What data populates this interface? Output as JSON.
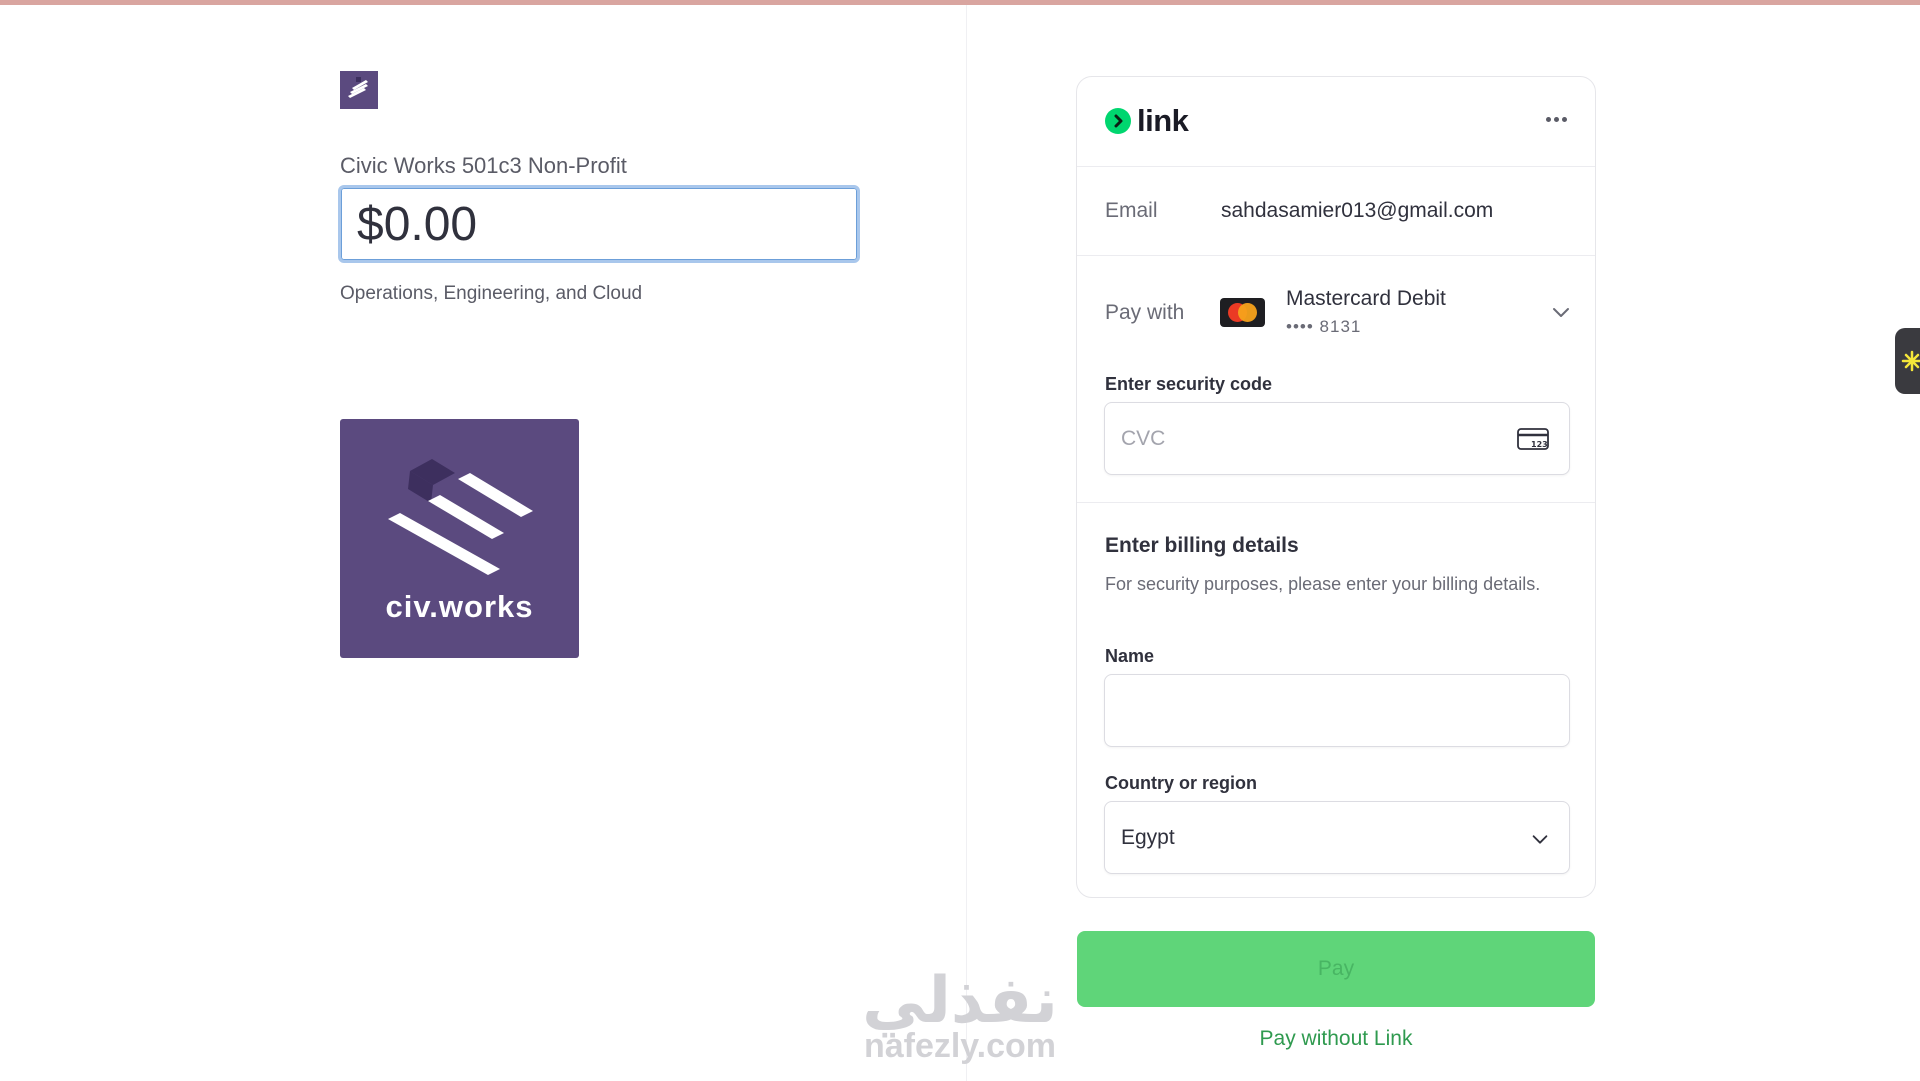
{
  "merchant": {
    "name": "Civic Works 501c3 Non-Profit",
    "amount": "$0.00",
    "description": "Operations, Engineering, and Cloud",
    "logo_text": "civ.works",
    "brand_color": "#5b4a7f"
  },
  "link": {
    "brand": "link",
    "badge_color": "#00d66f"
  },
  "email": {
    "label": "Email",
    "value": "sahdasamier013@gmail.com"
  },
  "pay_with": {
    "label": "Pay with",
    "card_name": "Mastercard Debit",
    "card_last4": "•••• 8131"
  },
  "security_code": {
    "label": "Enter security code",
    "placeholder": "CVC"
  },
  "billing": {
    "title": "Enter billing details",
    "description": "For security purposes, please enter your billing details.",
    "name_label": "Name",
    "name_value": "",
    "country_label": "Country or region",
    "country_value": "Egypt"
  },
  "actions": {
    "pay_label": "Pay",
    "pay_without_link": "Pay without Link",
    "pay_color": "#5fd579"
  },
  "watermark": {
    "arabic": "نفذلي",
    "latin": "nafezly.com"
  }
}
